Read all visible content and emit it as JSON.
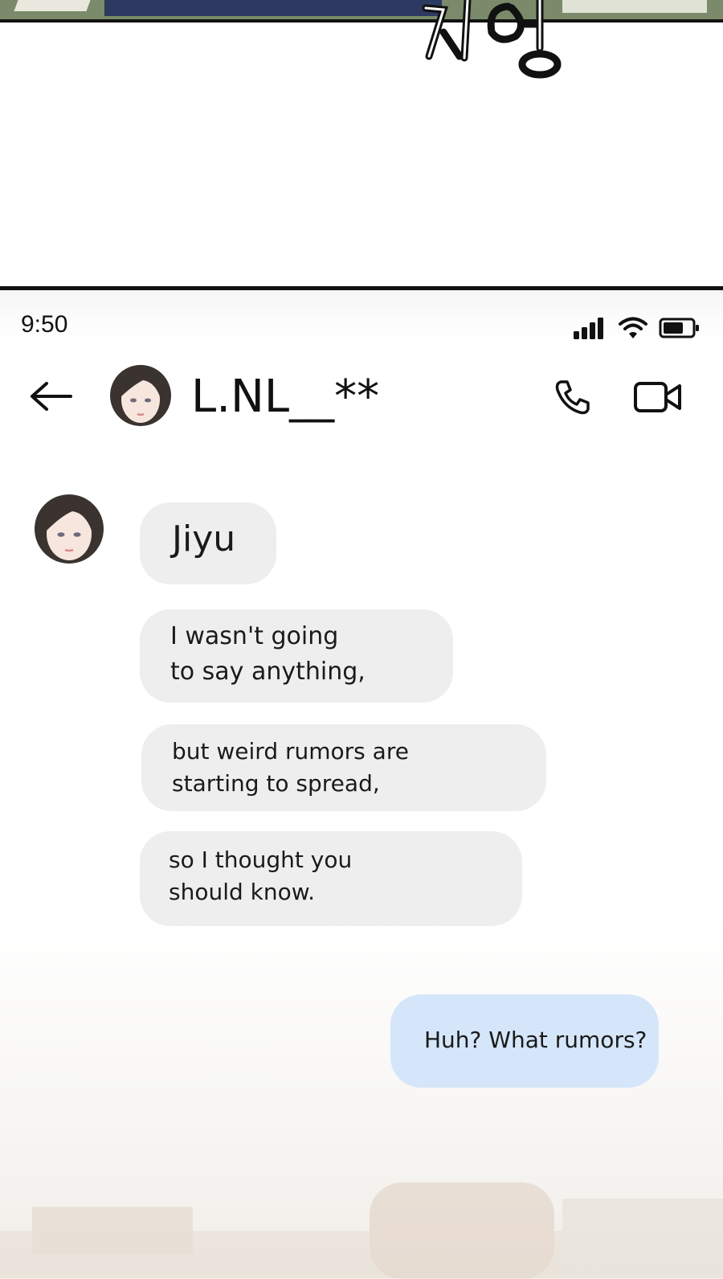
{
  "status_bar": {
    "time": "9:50",
    "icons": [
      "signal-icon",
      "wifi-icon",
      "battery-icon"
    ]
  },
  "chat_header": {
    "contact_name": "L.NL__**",
    "icons": [
      "back-arrow-icon",
      "phone-icon",
      "video-camera-icon"
    ]
  },
  "messages": [
    {
      "sender": "incoming",
      "text": "Jiyu"
    },
    {
      "sender": "incoming",
      "text": "I wasn't going\nto say anything,"
    },
    {
      "sender": "incoming",
      "text": "but weird rumors are\nstarting to spread,"
    },
    {
      "sender": "incoming",
      "text": "so I thought you\nshould know."
    },
    {
      "sender": "outgoing",
      "text": "Huh? What rumors?"
    }
  ],
  "colors": {
    "incoming_bubble": "#eeeeee",
    "outgoing_bubble": "#d6e6fa",
    "text": "#111111"
  }
}
